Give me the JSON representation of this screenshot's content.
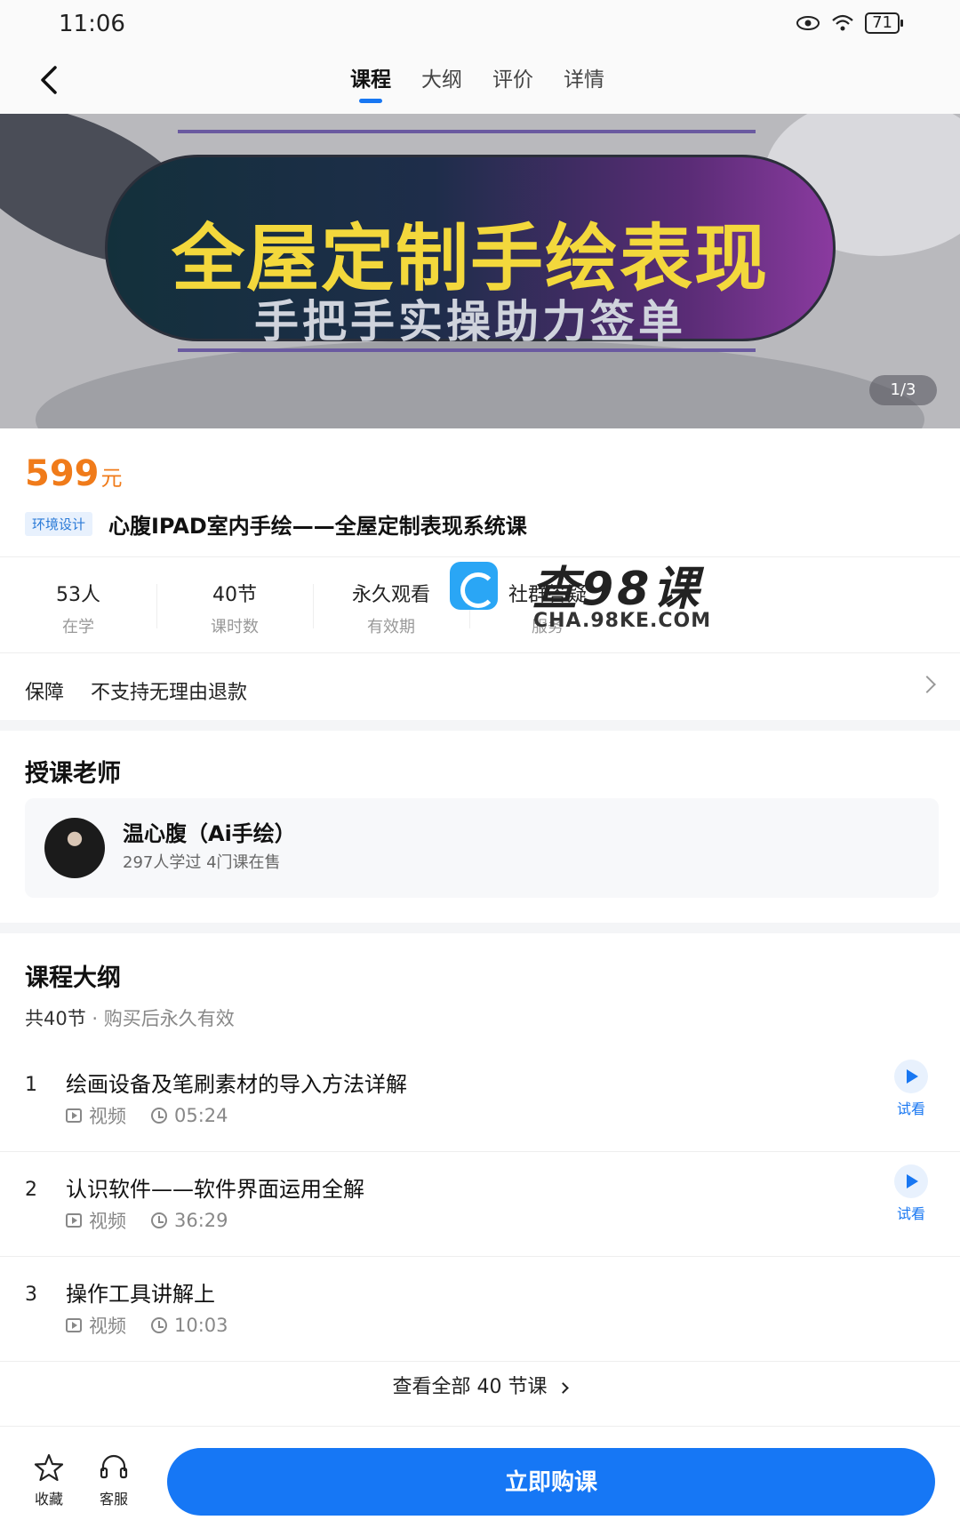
{
  "status_bar": {
    "time": "11:06",
    "battery": "71"
  },
  "nav": {
    "tabs": [
      "课程",
      "大纲",
      "评价",
      "详情"
    ],
    "active_tab": 0
  },
  "banner": {
    "title": "全屋定制手绘表现",
    "subtitle": "手把手实操助力签单",
    "pager": "1/3"
  },
  "course": {
    "price": "599",
    "price_unit": "元",
    "tag": "环境设计",
    "title": "心腹IPAD室内手绘——全屋定制表现系统课"
  },
  "stats": [
    {
      "value": "53人",
      "label": "在学"
    },
    {
      "value": "40节",
      "label": "课时数"
    },
    {
      "value": "永久观看",
      "label": "有效期"
    },
    {
      "value": "社群答疑",
      "label": "服务"
    }
  ],
  "watermark": {
    "text": "查98课",
    "url": "CHA.98KE.COM"
  },
  "guarantee": {
    "key": "保障",
    "value": "不支持无理由退款"
  },
  "teacher": {
    "section_title": "授课老师",
    "name": "温心腹（Ai手绘）",
    "meta": "297人学过  4门课在售"
  },
  "outline": {
    "section_title": "课程大纲",
    "count": "共40节",
    "validity": "购买后永久有效",
    "lessons": [
      {
        "index": "1",
        "title": "绘画设备及笔刷素材的导入方法详解",
        "type": "视频",
        "duration": "05:24",
        "trial": "试看"
      },
      {
        "index": "2",
        "title": "认识软件——软件界面运用全解",
        "type": "视频",
        "duration": "36:29",
        "trial": "试看"
      },
      {
        "index": "3",
        "title": "操作工具讲解上",
        "type": "视频",
        "duration": "10:03"
      }
    ],
    "view_all": "查看全部 40 节课"
  },
  "bottom_bar": {
    "favorite": "收藏",
    "service": "客服",
    "buy": "立即购课"
  }
}
